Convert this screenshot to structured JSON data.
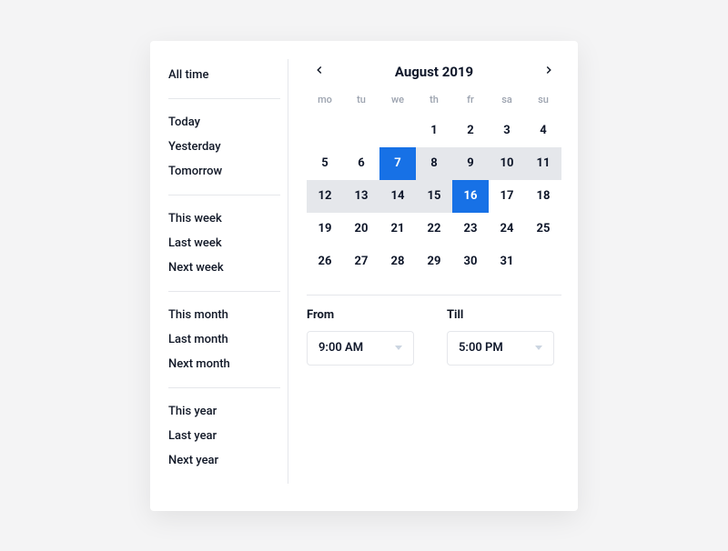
{
  "presets": {
    "groups": [
      [
        "All time"
      ],
      [
        "Today",
        "Yesterday",
        "Tomorrow"
      ],
      [
        "This week",
        "Last week",
        "Next week"
      ],
      [
        "This month",
        "Last month",
        "Next month"
      ],
      [
        "This year",
        "Last year",
        "Next year"
      ]
    ]
  },
  "calendar": {
    "title": "August 2019",
    "weekdays": [
      "mo",
      "tu",
      "we",
      "th",
      "fr",
      "sa",
      "su"
    ],
    "range_start": 7,
    "range_end": 16
  },
  "time": {
    "from_label": "From",
    "from_value": "9:00 AM",
    "till_label": "Till",
    "till_value": "5:00 PM"
  },
  "colors": {
    "accent": "#1771e6",
    "range_bg": "#e5e7eb"
  }
}
